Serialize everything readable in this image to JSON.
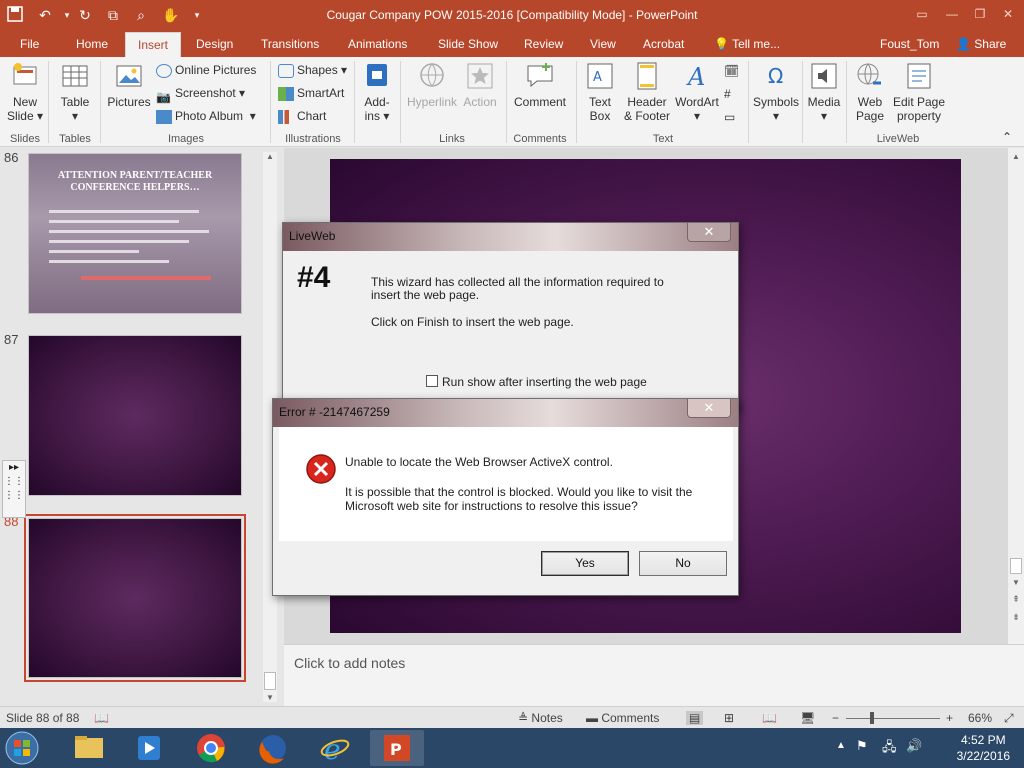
{
  "window": {
    "title": "Cougar Company POW 2015-2016 [Compatibility Mode] - PowerPoint"
  },
  "ribbon_tabs": [
    "File",
    "Home",
    "Insert",
    "Design",
    "Transitions",
    "Animations",
    "Slide Show",
    "Review",
    "View",
    "Acrobat"
  ],
  "tell_me": "Tell me...",
  "user": "Foust_Tom",
  "share": "Share",
  "ribbon": {
    "slides": {
      "new_slide": "New",
      "new_slide2": "Slide",
      "label": "Slides"
    },
    "tables": {
      "table": "Table",
      "label": "Tables"
    },
    "images": {
      "pictures": "Pictures",
      "online_pictures": "Online Pictures",
      "screenshot": "Screenshot",
      "photo_album": "Photo Album",
      "label": "Images"
    },
    "illustrations": {
      "shapes": "Shapes",
      "smartart": "SmartArt",
      "chart": "Chart",
      "label": "Illustrations"
    },
    "addins": {
      "addins": "Add-",
      "addins2": "ins"
    },
    "links": {
      "hyperlink": "Hyperlink",
      "action": "Action",
      "label": "Links"
    },
    "comments": {
      "comment": "Comment",
      "label": "Comments"
    },
    "text": {
      "textbox": "Text",
      "textbox2": "Box",
      "header": "Header",
      "header2": "& Footer",
      "wordart": "WordArt",
      "label": "Text"
    },
    "symbols": {
      "symbols": "Symbols"
    },
    "media": {
      "media": "Media"
    },
    "liveweb": {
      "webpage": "Web",
      "webpage2": "Page",
      "editpage": "Edit Page",
      "editpage2": "property",
      "label": "LiveWeb"
    }
  },
  "thumbnails": [
    {
      "number": "86",
      "title_line1": "ATTENTION PARENT/TEACHER",
      "title_line2": "CONFERENCE HELPERS…"
    },
    {
      "number": "87"
    },
    {
      "number": "88"
    }
  ],
  "notes_placeholder": "Click to add notes",
  "liveweb_dialog": {
    "title": "LiveWeb",
    "step": "#4",
    "line1": "This wizard has collected all the information required to",
    "line2": "insert the web page.",
    "line3": "Click on Finish to insert the web page.",
    "checkbox_label": "Run show after inserting the web page"
  },
  "error_dialog": {
    "title": "Error # -2147467259",
    "message1": "Unable to locate the Web Browser ActiveX control.",
    "message2": "It is possible that the control is blocked. Would you like to visit the",
    "message3": "Microsoft web site for instructions to resolve this issue?",
    "yes": "Yes",
    "no": "No"
  },
  "status": {
    "slide_info": "Slide 88 of 88",
    "notes": "Notes",
    "comments": "Comments",
    "zoom": "66%"
  },
  "taskbar": {
    "time": "4:52 PM",
    "date": "3/22/2016"
  },
  "colors": {
    "accent": "#b7472a",
    "taskbar": "#2b4767",
    "slide": "#4e1b52"
  }
}
